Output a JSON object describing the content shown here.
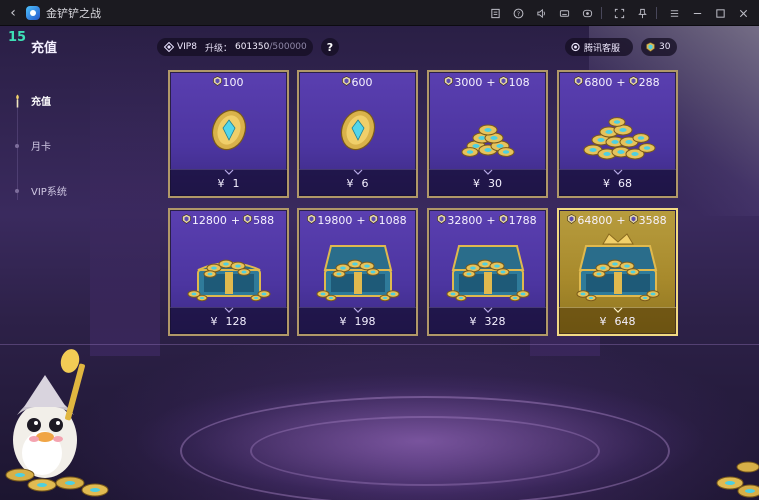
{
  "window": {
    "title": "金铲铲之战",
    "controls": [
      "note-icon",
      "help-circle-icon",
      "volume-icon",
      "keyboard-icon",
      "record-icon",
      "fullscreen-icon",
      "pin-icon",
      "menu-icon",
      "minimize-icon",
      "maximize-icon",
      "close-icon"
    ]
  },
  "header": {
    "logo_text": "15",
    "title": "充值",
    "vip": {
      "level": "VIP8",
      "progress_label": "升级：",
      "current": "601350",
      "slash": "/",
      "max": "500000"
    },
    "help": "?",
    "support_label": "腾讯客服",
    "balance": "30"
  },
  "sidebar": {
    "items": [
      {
        "label": "充值",
        "active": true
      },
      {
        "label": "月卡",
        "active": false
      },
      {
        "label": "VIP系统",
        "active": false
      }
    ]
  },
  "packs": [
    {
      "base": "100",
      "bonus": "",
      "price": "1",
      "art": "coin-single"
    },
    {
      "base": "600",
      "bonus": "",
      "price": "6",
      "art": "coin-single"
    },
    {
      "base": "3000",
      "bonus": "108",
      "price": "30",
      "art": "coin-stack-small"
    },
    {
      "base": "6800",
      "bonus": "288",
      "price": "68",
      "art": "coin-stack-large"
    },
    {
      "base": "12800",
      "bonus": "588",
      "price": "128",
      "art": "chest-small"
    },
    {
      "base": "19800",
      "bonus": "1088",
      "price": "198",
      "art": "chest-medium"
    },
    {
      "base": "32800",
      "bonus": "1788",
      "price": "328",
      "art": "chest-open"
    },
    {
      "base": "64800",
      "bonus": "3588",
      "price": "648",
      "art": "chest-grand",
      "highlight": true
    }
  ],
  "currency_symbol": "¥",
  "plus_sign": "+",
  "colors": {
    "card_bg": "#5a3fb0",
    "card_border": "#b09868",
    "gold_card": "#b79c3e",
    "accent_teal": "#3ee0b6"
  }
}
